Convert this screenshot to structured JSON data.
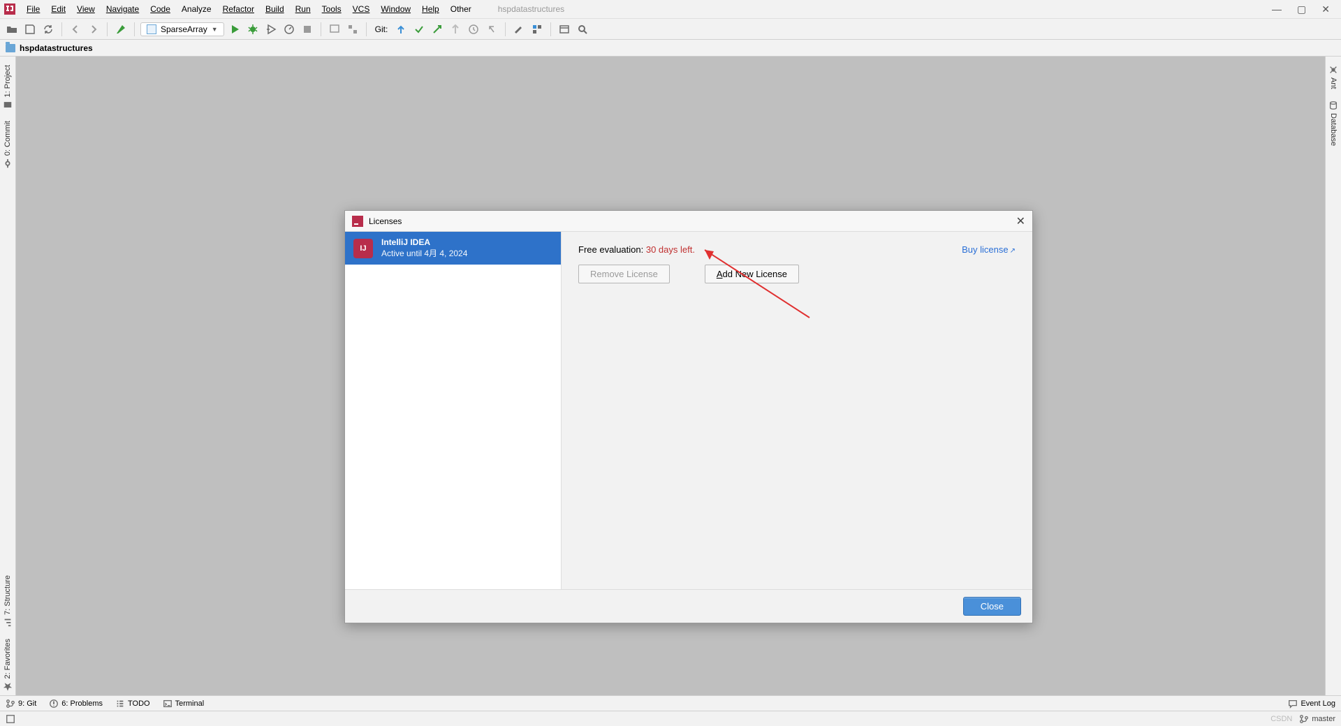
{
  "app": {
    "project_title": "hspdatastructures"
  },
  "menu": {
    "items": [
      "File",
      "Edit",
      "View",
      "Navigate",
      "Code",
      "Analyze",
      "Refactor",
      "Build",
      "Run",
      "Tools",
      "VCS",
      "Window",
      "Help",
      "Other"
    ]
  },
  "toolbar": {
    "run_config": "SparseArray",
    "git_label": "Git:"
  },
  "breadcrumb": {
    "project": "hspdatastructures"
  },
  "left_tabs": {
    "project": "1: Project",
    "commit": "0: Commit",
    "structure": "7: Structure",
    "favorites": "2: Favorites"
  },
  "right_tabs": {
    "ant": "Ant",
    "database": "Database"
  },
  "bottom_tabs": {
    "git": "9: Git",
    "problems": "6: Problems",
    "todo": "TODO",
    "terminal": "Terminal",
    "event_log": "Event Log"
  },
  "statusbar": {
    "watermark": "CSDN",
    "branch": "master"
  },
  "dialog": {
    "title": "Licenses",
    "product_name": "IntelliJ IDEA",
    "product_status": "Active until 4月 4, 2024",
    "eval_prefix": "Free evaluation: ",
    "eval_days": "30 days left.",
    "buy_link": "Buy license",
    "remove_btn": "Remove License",
    "add_btn_pre": "A",
    "add_btn_rest": "dd New License",
    "close_btn": "Close"
  }
}
